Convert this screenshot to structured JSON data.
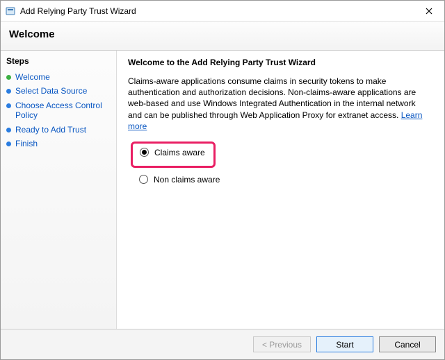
{
  "window": {
    "title": "Add Relying Party Trust Wizard"
  },
  "banner": {
    "heading": "Welcome"
  },
  "sidebar": {
    "heading": "Steps",
    "items": [
      {
        "label": "Welcome",
        "state": "done"
      },
      {
        "label": "Select Data Source",
        "state": "pending"
      },
      {
        "label": "Choose Access Control Policy",
        "state": "pending"
      },
      {
        "label": "Ready to Add Trust",
        "state": "pending"
      },
      {
        "label": "Finish",
        "state": "pending"
      }
    ]
  },
  "content": {
    "heading": "Welcome to the Add Relying Party Trust Wizard",
    "paragraph": "Claims-aware applications consume claims in security tokens to make authentication and authorization decisions. Non-claims-aware applications are web-based and use Windows Integrated Authentication in the internal network and can be published through Web Application Proxy for extranet access. ",
    "learn_more": "Learn more",
    "options": [
      {
        "label": "Claims aware",
        "selected": true
      },
      {
        "label": "Non claims aware",
        "selected": false
      }
    ]
  },
  "footer": {
    "previous": "< Previous",
    "start": "Start",
    "cancel": "Cancel"
  }
}
